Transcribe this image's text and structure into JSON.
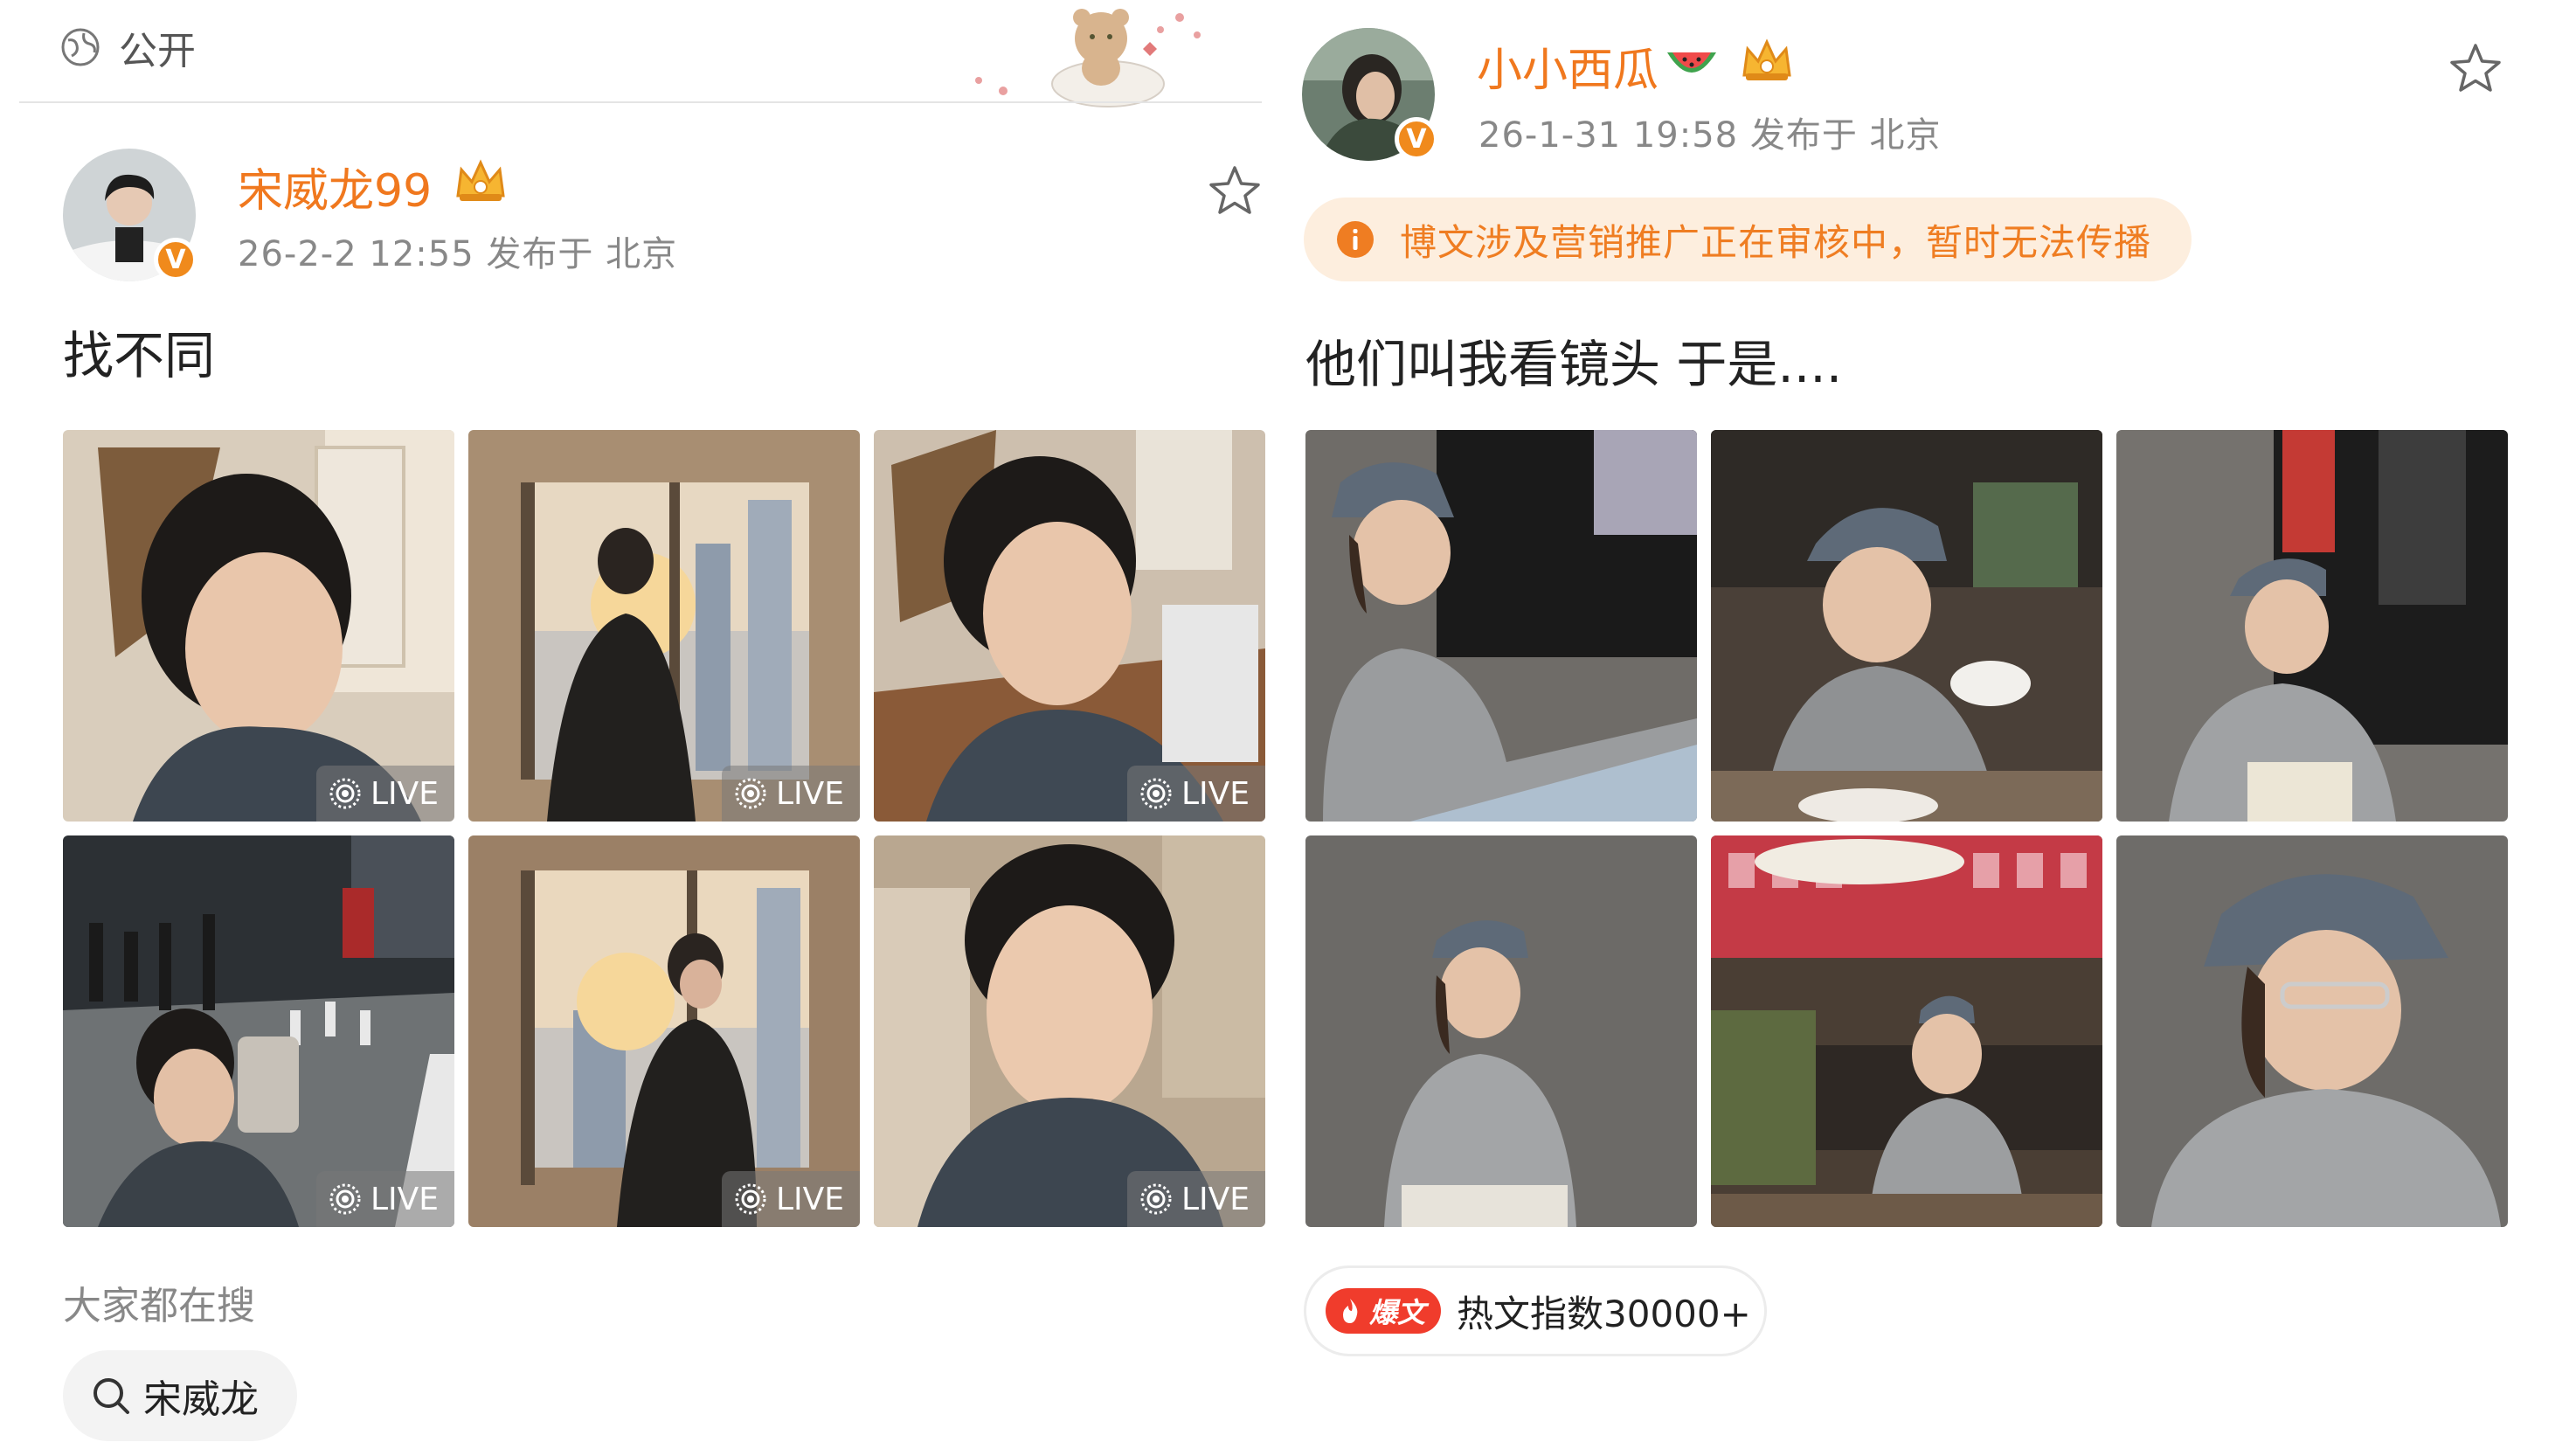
{
  "left_post": {
    "visibility": "公开",
    "username": "宋威龙99",
    "meta": "26-2-2 12:55  发布于 北京",
    "text": "找不同",
    "live_label": "LIVE",
    "photos": [
      {
        "live": true
      },
      {
        "live": true
      },
      {
        "live": true
      },
      {
        "live": true
      },
      {
        "live": true
      },
      {
        "live": true
      }
    ],
    "search_label": "大家都在搜",
    "search_chip": "宋威龙"
  },
  "right_post": {
    "username": "小小西瓜",
    "meta": "26-1-31 19:58  发布于 北京",
    "notice": "博文涉及营销推广正在审核中，暂时无法传播",
    "text": "他们叫我看镜头  于是....",
    "hot_tag": "爆文",
    "hot_text": "热文指数30000+"
  },
  "colors": {
    "username": "#f0781e",
    "notice_bg": "#fdeede",
    "hot_tag": "#f03c2c",
    "live_badge": "#787878"
  }
}
